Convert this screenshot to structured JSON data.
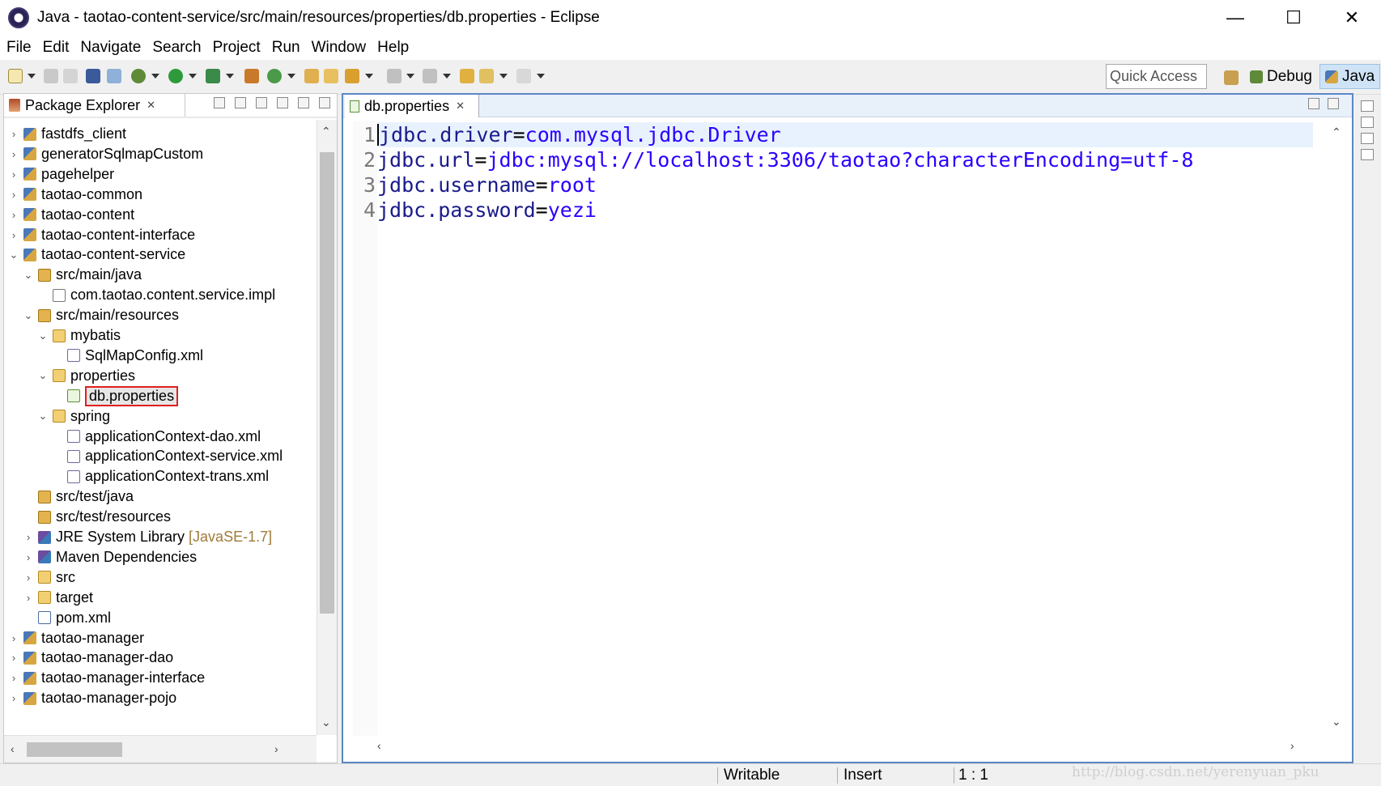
{
  "window": {
    "title": "Java - taotao-content-service/src/main/resources/properties/db.properties - Eclipse",
    "minimize": "—",
    "maximize": "☐",
    "close": "✕"
  },
  "menu": [
    "File",
    "Edit",
    "Navigate",
    "Search",
    "Project",
    "Run",
    "Window",
    "Help"
  ],
  "toolbar": {
    "quick_access_placeholder": "Quick Access",
    "perspectives": [
      {
        "label": "Debug",
        "active": false
      },
      {
        "label": "Java",
        "active": true
      }
    ]
  },
  "package_explorer": {
    "tab_label": "Package Explorer",
    "tab_close": "✕",
    "tree": [
      {
        "label": "fastdfs_client",
        "icon": "project-icon",
        "twisty": "›",
        "depth": 0
      },
      {
        "label": "generatorSqlmapCustom",
        "icon": "project-icon",
        "twisty": "›",
        "depth": 0
      },
      {
        "label": "pagehelper",
        "icon": "project-icon",
        "twisty": "›",
        "depth": 0
      },
      {
        "label": "taotao-common",
        "icon": "project-icon",
        "twisty": "›",
        "depth": 0
      },
      {
        "label": "taotao-content",
        "icon": "project-icon",
        "twisty": "›",
        "depth": 0
      },
      {
        "label": "taotao-content-interface",
        "icon": "project-icon",
        "twisty": "›",
        "depth": 0
      },
      {
        "label": "taotao-content-service",
        "icon": "project-icon",
        "twisty": "⌄",
        "depth": 0
      },
      {
        "label": "src/main/java",
        "icon": "source-folder-icon",
        "twisty": "⌄",
        "depth": 1
      },
      {
        "label": "com.taotao.content.service.impl",
        "icon": "package-icon",
        "twisty": "",
        "depth": 2
      },
      {
        "label": "src/main/resources",
        "icon": "source-folder-icon",
        "twisty": "⌄",
        "depth": 1
      },
      {
        "label": "mybatis",
        "icon": "folder-icon",
        "twisty": "⌄",
        "depth": 2
      },
      {
        "label": "SqlMapConfig.xml",
        "icon": "xml-file-icon",
        "twisty": "",
        "depth": 3
      },
      {
        "label": "properties",
        "icon": "folder-icon",
        "twisty": "⌄",
        "depth": 2
      },
      {
        "label": "db.properties",
        "icon": "properties-file-icon",
        "twisty": "",
        "depth": 3,
        "selected": true
      },
      {
        "label": "spring",
        "icon": "folder-icon",
        "twisty": "⌄",
        "depth": 2
      },
      {
        "label": "applicationContext-dao.xml",
        "icon": "xml-file-icon",
        "twisty": "",
        "depth": 3
      },
      {
        "label": "applicationContext-service.xml",
        "icon": "xml-file-icon",
        "twisty": "",
        "depth": 3
      },
      {
        "label": "applicationContext-trans.xml",
        "icon": "xml-file-icon",
        "twisty": "",
        "depth": 3
      },
      {
        "label": "src/test/java",
        "icon": "source-folder-icon",
        "twisty": "",
        "depth": 1
      },
      {
        "label": "src/test/resources",
        "icon": "source-folder-icon",
        "twisty": "",
        "depth": 1
      },
      {
        "label": "JRE System Library",
        "suffix": "[JavaSE-1.7]",
        "icon": "library-icon",
        "twisty": "›",
        "depth": 1
      },
      {
        "label": "Maven Dependencies",
        "icon": "library-icon",
        "twisty": "›",
        "depth": 1
      },
      {
        "label": "src",
        "icon": "folder-icon",
        "twisty": "›",
        "depth": 1
      },
      {
        "label": "target",
        "icon": "folder-icon",
        "twisty": "›",
        "depth": 1
      },
      {
        "label": "pom.xml",
        "icon": "pom-file-icon",
        "twisty": "",
        "depth": 1
      },
      {
        "label": "taotao-manager",
        "icon": "project-icon",
        "twisty": "›",
        "depth": 0
      },
      {
        "label": "taotao-manager-dao",
        "icon": "project-icon",
        "twisty": "›",
        "depth": 0
      },
      {
        "label": "taotao-manager-interface",
        "icon": "project-icon",
        "twisty": "›",
        "depth": 0
      },
      {
        "label": "taotao-manager-pojo",
        "icon": "project-icon",
        "twisty": "›",
        "depth": 0
      }
    ]
  },
  "editor": {
    "tab_label": "db.properties",
    "tab_close": "✕",
    "lines": [
      {
        "num": "1",
        "key": "jdbc.driver",
        "eq": "=",
        "value": "com.mysql.jdbc.Driver"
      },
      {
        "num": "2",
        "key": "jdbc.url",
        "eq": "=",
        "value": "jdbc:mysql://localhost:3306/taotao?characterEncoding=utf-8"
      },
      {
        "num": "3",
        "key": "jdbc.username",
        "eq": "=",
        "value": "root"
      },
      {
        "num": "4",
        "key": "jdbc.password",
        "eq": "=",
        "value": "yezi"
      }
    ]
  },
  "status": {
    "writable": "Writable",
    "insert_mode": "Insert",
    "position": "1 : 1",
    "watermark": "http://blog.csdn.net/yerenyuan_pku"
  },
  "colors": {
    "selection_border": "#e02020",
    "editor_border": "#5b87c6",
    "current_line": "#e8f2fe"
  }
}
